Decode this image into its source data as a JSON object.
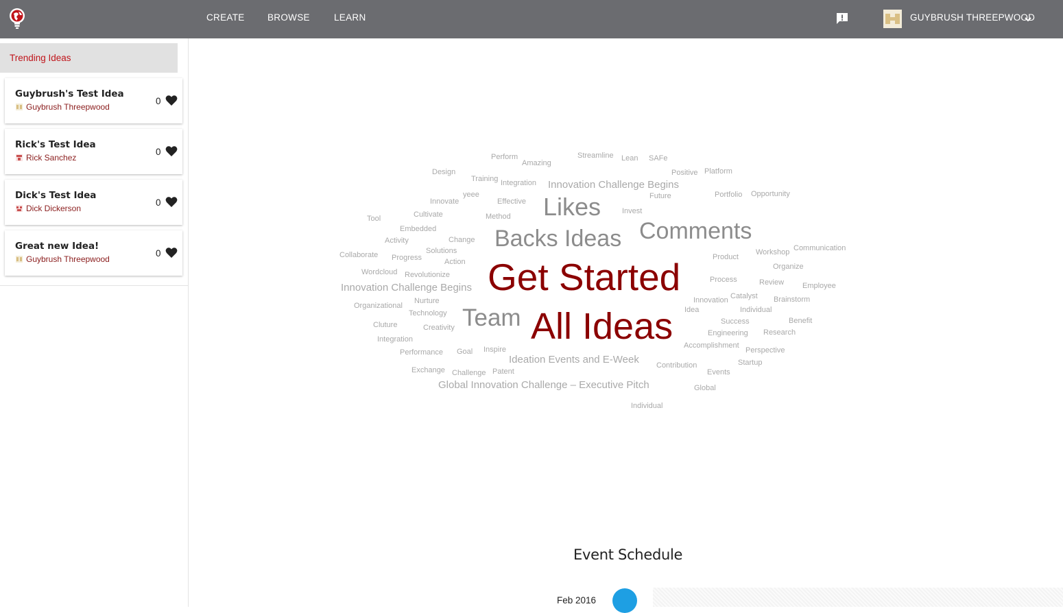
{
  "nav": {
    "create": "CREATE",
    "browse": "BROWSE",
    "learn": "LEARN",
    "user_name": "GUYBRUSH THREEPWOOD"
  },
  "sidebar": {
    "header": "Trending Ideas",
    "ideas": [
      {
        "title": "Guybrush's Test Idea",
        "author": "Guybrush Threepwood",
        "likes": "0"
      },
      {
        "title": "Rick's Test Idea",
        "author": "Rick Sanchez",
        "likes": "0"
      },
      {
        "title": "Dick's Test Idea",
        "author": "Dick Dickerson",
        "likes": "0"
      },
      {
        "title": "Great new Idea!",
        "author": "Guybrush Threepwood",
        "likes": "0"
      }
    ]
  },
  "word_cloud": [
    "Perform",
    "Amazing",
    "Streamline",
    "Lean",
    "SAFe",
    "Design",
    "Positive",
    "Platform",
    "Training",
    "Integration",
    "Innovation Challenge Begins",
    "yeee",
    "Innovate",
    "Effective",
    "Future",
    "Portfolio",
    "Opportunity",
    "Likes",
    "Invest",
    "Tool",
    "Cultivate",
    "Method",
    "Embedded",
    "Comments",
    "Activity",
    "Change",
    "Backs Ideas",
    "Communication",
    "Solutions",
    "Workshop",
    "Collaborate",
    "Progress",
    "Product",
    "Action",
    "Organize",
    "Wordcloud",
    "Revolutionize",
    "Get Started",
    "Process",
    "Review",
    "Innovation Challenge Begins",
    "Employee",
    "Nurture",
    "Innovation",
    "Catalyst",
    "Brainstorm",
    "Organizational",
    "Idea",
    "Individual",
    "Technology",
    "Team",
    "Cluture",
    "Creativity",
    "All Ideas",
    "Success",
    "Benefit",
    "Engineering",
    "Research",
    "Integration",
    "Accomplishment",
    "Performance",
    "Goal",
    "Inspire",
    "Perspective",
    "Ideation Events and E-Week",
    "Contribution",
    "Startup",
    "Exchange",
    "Challenge",
    "Patent",
    "Events",
    "Global Innovation Challenge – Executive Pitch",
    "Global",
    "Individual"
  ],
  "schedule": {
    "title": "Event Schedule",
    "month": "Feb 2016"
  },
  "colors": {
    "topbar": "#6b6c70",
    "accent_red": "#c0141a",
    "hot_word": "#8b0000",
    "timeline_dot": "#1e9fe3"
  }
}
